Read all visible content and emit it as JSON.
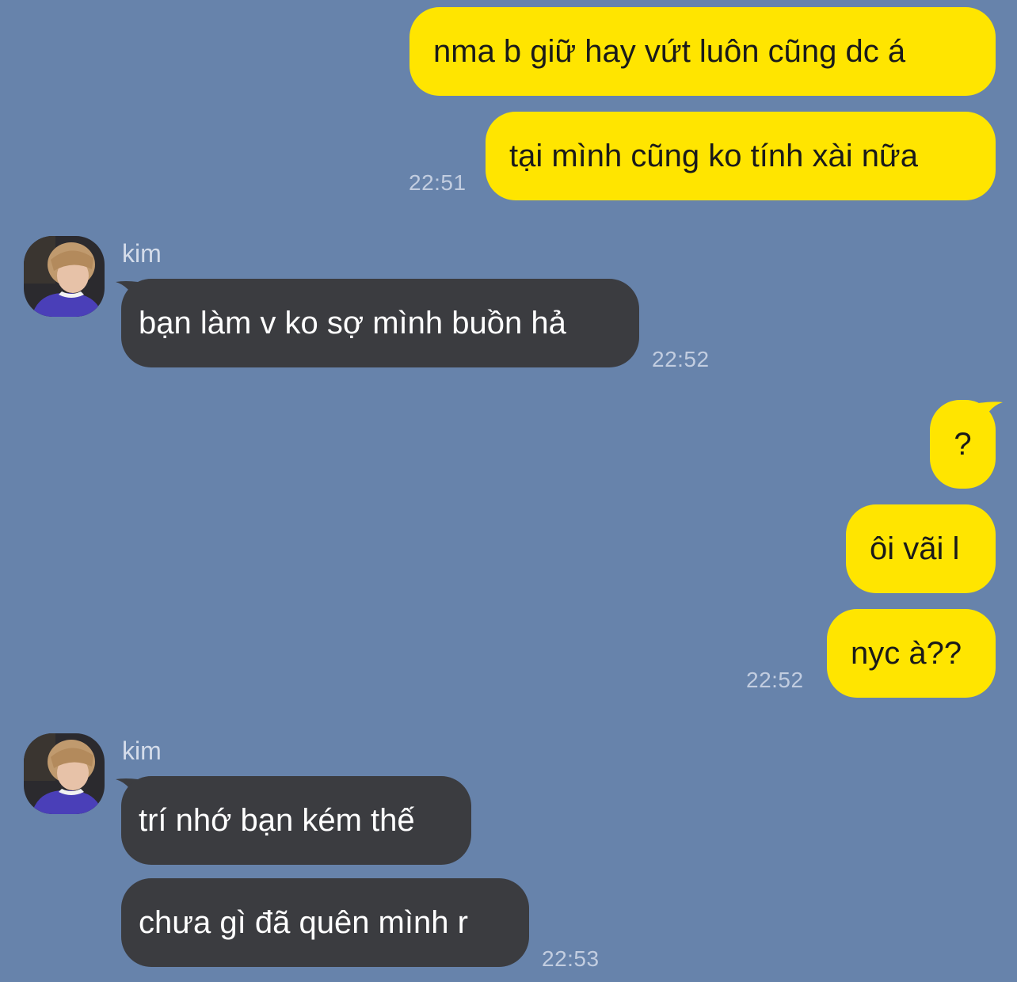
{
  "colors": {
    "background": "#6783ab",
    "outgoing_bubble": "#ffe500",
    "incoming_bubble": "#3b3c40",
    "timestamp": "#c2cde0"
  },
  "messages": {
    "m1": {
      "text": "nma b giữ hay vứt luôn cũng dc á"
    },
    "m2": {
      "text": "tại mình cũng ko tính xài nữa",
      "time": "22:51"
    },
    "m3": {
      "sender": "kim",
      "text": "bạn làm v ko sợ mình buồn hả",
      "time": "22:52"
    },
    "m4": {
      "text": "?"
    },
    "m5": {
      "text": "ôi vãi l"
    },
    "m6": {
      "text": "nyc à??",
      "time": "22:52"
    },
    "m7": {
      "sender": "kim",
      "text": "trí nhớ bạn kém thế"
    },
    "m8": {
      "text": "chưa gì đã quên mình r",
      "time": "22:53"
    }
  },
  "avatar_icon": "profile-photo-icon"
}
